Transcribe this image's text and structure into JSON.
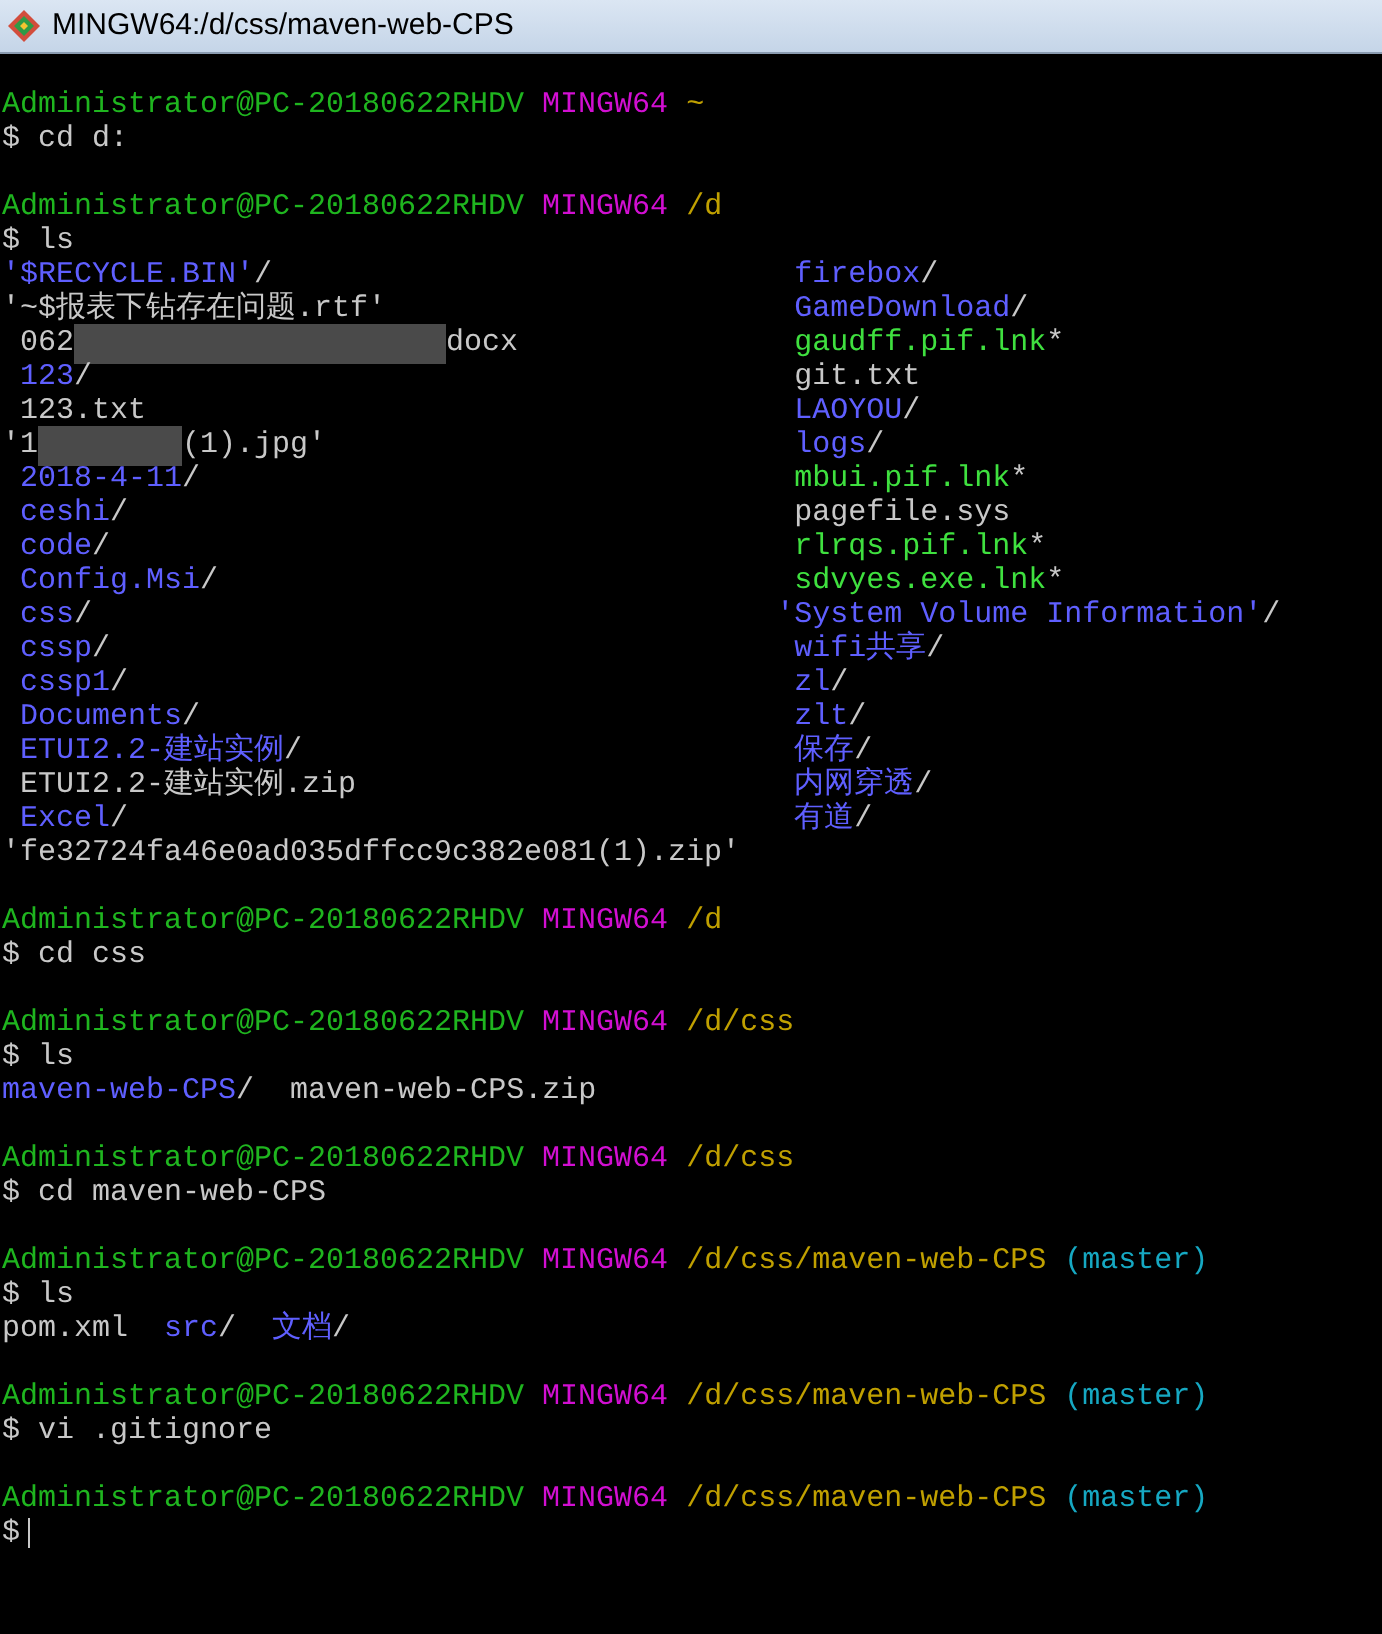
{
  "window": {
    "title": "MINGW64:/d/css/maven-web-CPS"
  },
  "lines": [
    {
      "kind": "blank"
    },
    {
      "kind": "prompt",
      "user": "Administrator@PC-20180622RHDV",
      "system": "MINGW64",
      "path": "~"
    },
    {
      "kind": "command",
      "text": "$ cd d:"
    },
    {
      "kind": "blank"
    },
    {
      "kind": "prompt",
      "user": "Administrator@PC-20180622RHDV",
      "system": "MINGW64",
      "path": "/d"
    },
    {
      "kind": "command",
      "text": "$ ls"
    },
    {
      "kind": "listing",
      "left": [
        {
          "text": "'$RECYCLE.BIN'/",
          "kind": "dir",
          "quoted": true
        },
        {
          "text": "'~$报表下钻存在问题.rtf'",
          "kind": "file",
          "quoted": true
        },
        {
          "text": "062",
          "after": "docx",
          "kind": "file",
          "quoted": false,
          "blur": {
            "kind": "long"
          }
        },
        {
          "text": "123/",
          "kind": "dir",
          "quoted": false
        },
        {
          "text": "123.txt",
          "kind": "file",
          "quoted": false
        },
        {
          "text": "'1",
          "after": "(1).jpg'",
          "kind": "file",
          "quoted": true,
          "blur": {
            "kind": "short"
          }
        },
        {
          "text": "2018-4-11/",
          "kind": "dir",
          "quoted": false
        },
        {
          "text": "ceshi/",
          "kind": "dir",
          "quoted": false
        },
        {
          "text": "code/",
          "kind": "dir",
          "quoted": false
        },
        {
          "text": "Config.Msi/",
          "kind": "dir",
          "quoted": false
        },
        {
          "text": "css/",
          "kind": "dir",
          "quoted": false
        },
        {
          "text": "cssp/",
          "kind": "dir",
          "quoted": false
        },
        {
          "text": "cssp1/",
          "kind": "dir",
          "quoted": false
        },
        {
          "text": "Documents/",
          "kind": "dir",
          "quoted": false
        },
        {
          "text": "ETUI2.2-建站实例/",
          "kind": "dir",
          "quoted": false
        },
        {
          "text": "ETUI2.2-建站实例.zip",
          "kind": "file",
          "quoted": false
        },
        {
          "text": "Excel/",
          "kind": "dir",
          "quoted": false
        },
        {
          "text": "'fe32724fa46e0ad035dffcc9c382e081(1).zip'",
          "kind": "file",
          "quoted": true
        }
      ],
      "right": [
        {
          "text": "firebox/",
          "kind": "dir",
          "quoted": false
        },
        {
          "text": "GameDownload/",
          "kind": "dir",
          "quoted": false
        },
        {
          "text": "gaudff.pif.lnk*",
          "kind": "exec",
          "quoted": false
        },
        {
          "text": "git.txt",
          "kind": "file",
          "quoted": false
        },
        {
          "text": "LAOYOU/",
          "kind": "dir",
          "quoted": false
        },
        {
          "text": "logs/",
          "kind": "dir",
          "quoted": false
        },
        {
          "text": "mbui.pif.lnk*",
          "kind": "exec",
          "quoted": false
        },
        {
          "text": "pagefile.sys",
          "kind": "file",
          "quoted": false
        },
        {
          "text": "rlrqs.pif.lnk*",
          "kind": "exec",
          "quoted": false
        },
        {
          "text": "sdvyes.exe.lnk*",
          "kind": "exec",
          "quoted": false
        },
        {
          "text": "'System Volume Information'/",
          "kind": "dir",
          "quoted": true
        },
        {
          "text": "wifi共享/",
          "kind": "dir",
          "quoted": false
        },
        {
          "text": "zl/",
          "kind": "dir",
          "quoted": false
        },
        {
          "text": "zlt/",
          "kind": "dir",
          "quoted": false
        },
        {
          "text": "保存/",
          "kind": "dir",
          "quoted": false
        },
        {
          "text": "内网穿透/",
          "kind": "dir",
          "quoted": false
        },
        {
          "text": "有道/",
          "kind": "dir",
          "quoted": false
        }
      ]
    },
    {
      "kind": "blank"
    },
    {
      "kind": "prompt",
      "user": "Administrator@PC-20180622RHDV",
      "system": "MINGW64",
      "path": "/d"
    },
    {
      "kind": "command",
      "text": "$ cd css"
    },
    {
      "kind": "blank"
    },
    {
      "kind": "prompt",
      "user": "Administrator@PC-20180622RHDV",
      "system": "MINGW64",
      "path": "/d/css"
    },
    {
      "kind": "command",
      "text": "$ ls"
    },
    {
      "kind": "output",
      "items": [
        {
          "text": "maven-web-CPS/",
          "kind": "dir"
        },
        {
          "text": "maven-web-CPS.zip",
          "kind": "file"
        }
      ]
    },
    {
      "kind": "blank"
    },
    {
      "kind": "prompt",
      "user": "Administrator@PC-20180622RHDV",
      "system": "MINGW64",
      "path": "/d/css"
    },
    {
      "kind": "command",
      "text": "$ cd maven-web-CPS"
    },
    {
      "kind": "blank"
    },
    {
      "kind": "prompt",
      "user": "Administrator@PC-20180622RHDV",
      "system": "MINGW64",
      "path": "/d/css/maven-web-CPS",
      "branch": "(master)"
    },
    {
      "kind": "command",
      "text": "$ ls"
    },
    {
      "kind": "output",
      "items": [
        {
          "text": "pom.xml",
          "kind": "file"
        },
        {
          "text": "src/",
          "kind": "dir"
        },
        {
          "text": "文档/",
          "kind": "dir"
        }
      ]
    },
    {
      "kind": "blank"
    },
    {
      "kind": "prompt",
      "user": "Administrator@PC-20180622RHDV",
      "system": "MINGW64",
      "path": "/d/css/maven-web-CPS",
      "branch": "(master)"
    },
    {
      "kind": "command",
      "text": "$ vi .gitignore"
    },
    {
      "kind": "blank"
    },
    {
      "kind": "prompt",
      "user": "Administrator@PC-20180622RHDV",
      "system": "MINGW64",
      "path": "/d/css/maven-web-CPS",
      "branch": "(master)"
    },
    {
      "kind": "command",
      "text": "$",
      "cursor": true
    }
  ]
}
